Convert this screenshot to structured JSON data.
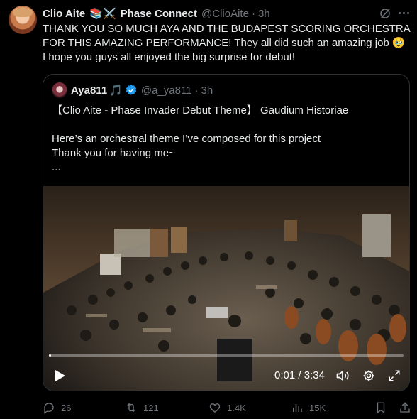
{
  "tweet": {
    "author_name": "Clio Aite",
    "emoji_badges": "📚⚔️",
    "affiliation": "Phase Connect",
    "handle": "@ClioAite",
    "separator": "·",
    "time": "3h",
    "text": "THANK YOU SO MUCH AYA AND THE BUDAPEST SCORING ORCHESTRA FOR THIS AMAZING PERFORMANCE! They all did such an amazing job 🥹\nI hope you guys all enjoyed the big surprise for debut!"
  },
  "quote": {
    "author_name": "Aya811",
    "music_badge": "🎵",
    "handle": "@a_ya811",
    "separator": "·",
    "time": "3h",
    "text": "【Clio Aite - Phase Invader Debut Theme】 Gaudium Historiae\n\nHere’s an orchestral theme I’ve composed for this project\nThank you for having me~\n..."
  },
  "video": {
    "current_time": "0:01",
    "duration": "3:34",
    "time_display": "0:01 / 3:34",
    "progress": 0.005
  },
  "actions": {
    "replies": "26",
    "reposts": "121",
    "likes": "1.4K",
    "views": "15K"
  },
  "icons": [
    "grok-icon",
    "more-icon",
    "verified-icon",
    "play-icon",
    "volume-icon",
    "gear-icon",
    "expand-icon",
    "reply-icon",
    "repost-icon",
    "like-icon",
    "views-icon",
    "bookmark-icon",
    "share-icon"
  ],
  "colors": {
    "background": "#000000",
    "text": "#e7e9ea",
    "muted": "#71767b",
    "accent": "#1d9bf0",
    "border": "#2f3336"
  }
}
